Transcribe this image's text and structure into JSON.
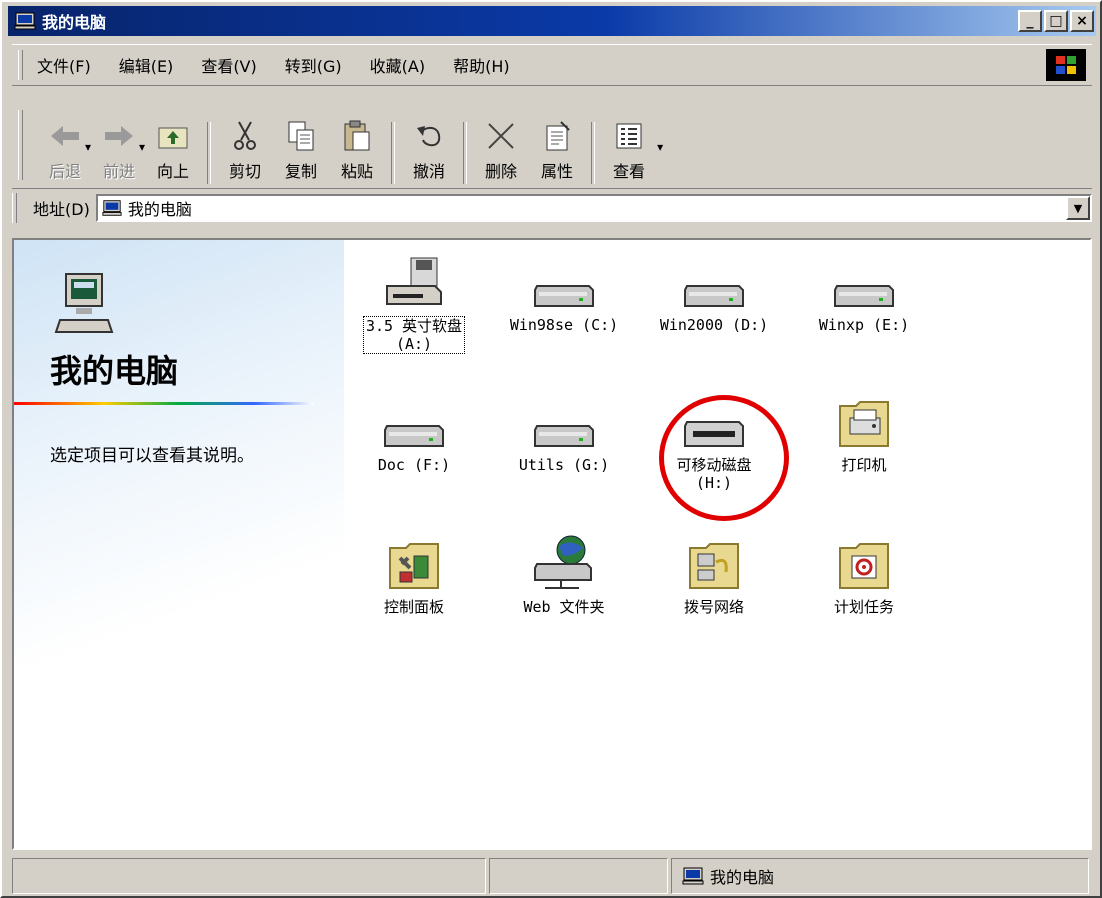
{
  "window": {
    "title": "我的电脑",
    "buttons": [
      "_",
      "□",
      "×"
    ]
  },
  "menubar": {
    "items": [
      "文件(F)",
      "编辑(E)",
      "查看(V)",
      "转到(G)",
      "收藏(A)",
      "帮助(H)"
    ]
  },
  "toolbar": {
    "back": "后退",
    "forward": "前进",
    "up": "向上",
    "cut": "剪切",
    "copy": "复制",
    "paste": "粘贴",
    "undo": "撤消",
    "delete": "删除",
    "properties": "属性",
    "views": "查看"
  },
  "address": {
    "label": "地址(D)",
    "value": "我的电脑"
  },
  "leftpane": {
    "title": "我的电脑",
    "description": "选定项目可以查看其说明。"
  },
  "items": [
    {
      "label": "3.5 英寸软盘\n(A:)",
      "icon": "floppy-drive-icon"
    },
    {
      "label": "Win98se (C:)",
      "icon": "hard-drive-icon"
    },
    {
      "label": "Win2000 (D:)",
      "icon": "hard-drive-icon"
    },
    {
      "label": "Winxp (E:)",
      "icon": "hard-drive-icon"
    },
    {
      "label": "Doc (F:)",
      "icon": "hard-drive-icon"
    },
    {
      "label": "Utils (G:)",
      "icon": "hard-drive-icon"
    },
    {
      "label": "可移动磁盘\n(H:)",
      "icon": "removable-disk-icon"
    },
    {
      "label": "打印机",
      "icon": "printers-folder-icon"
    },
    {
      "label": "控制面板",
      "icon": "control-panel-icon"
    },
    {
      "label": "Web 文件夹",
      "icon": "web-folders-icon"
    },
    {
      "label": "拨号网络",
      "icon": "dial-up-networking-icon"
    },
    {
      "label": "计划任务",
      "icon": "scheduled-tasks-icon"
    }
  ],
  "statusbar": {
    "zone": "我的电脑"
  },
  "colors": {
    "titlebar": "#08246b",
    "face": "#d4d0c8",
    "highlight": "#e00000"
  }
}
